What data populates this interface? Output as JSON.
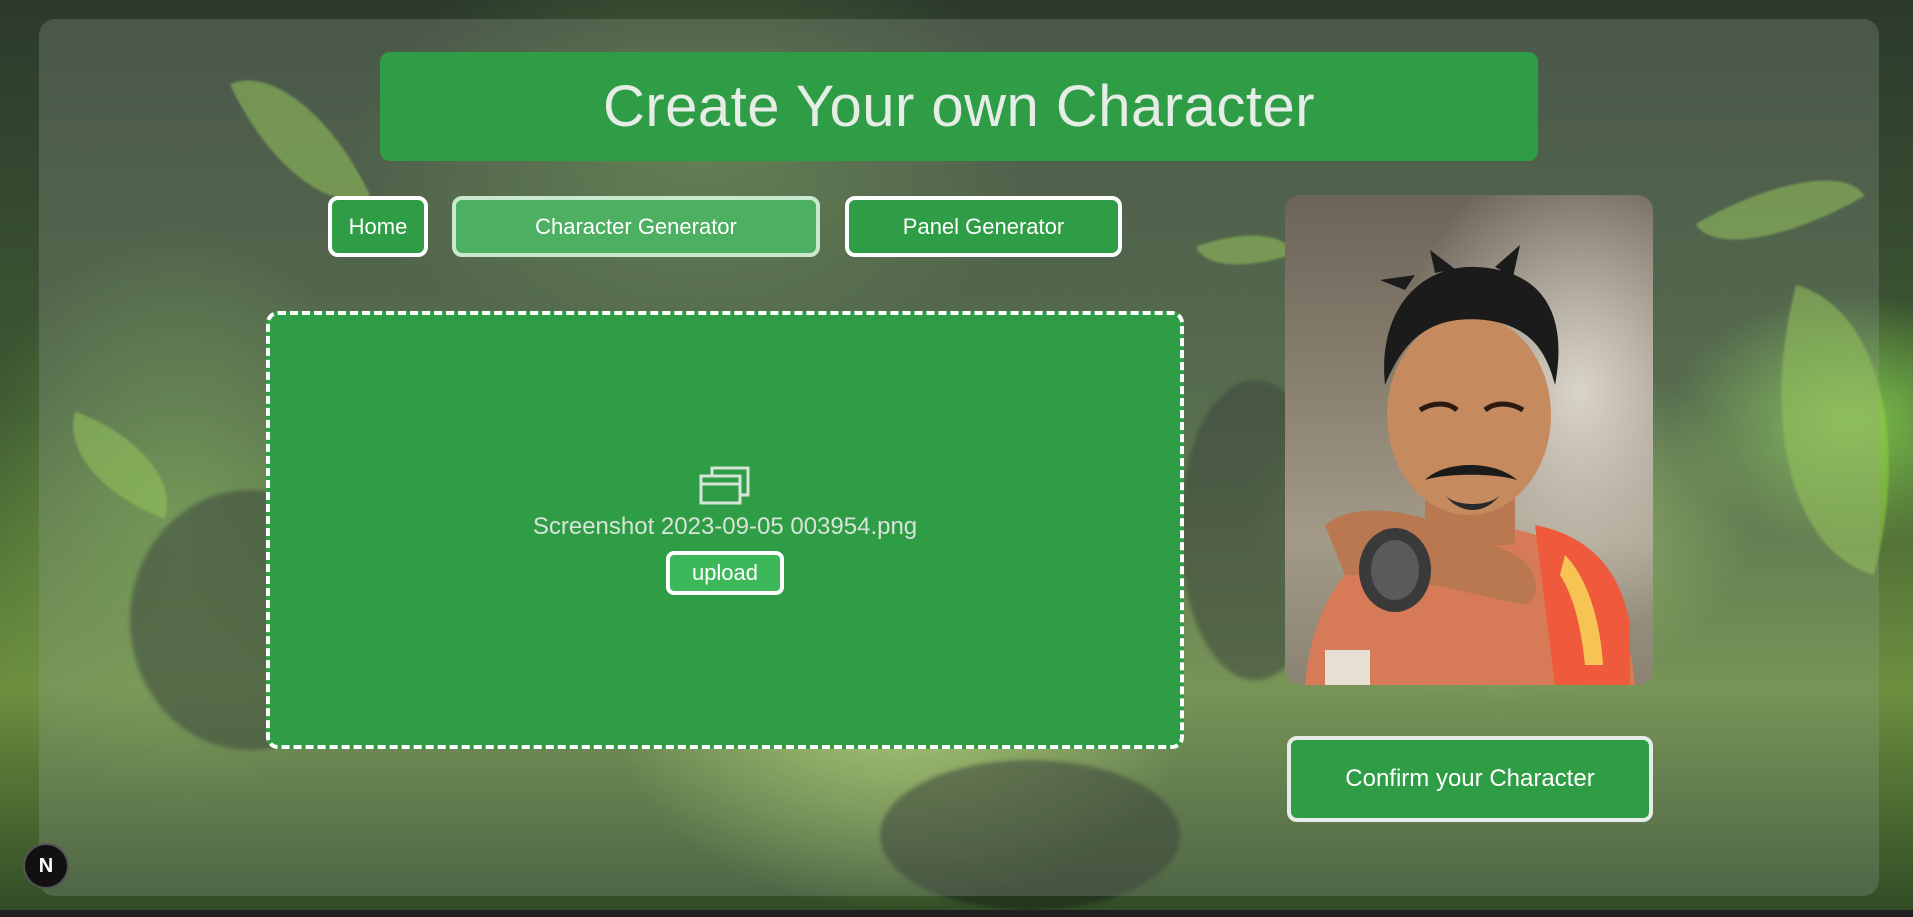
{
  "page": {
    "title": "Create Your own Character"
  },
  "nav": {
    "items": [
      {
        "label": "Home",
        "active": false
      },
      {
        "label": "Character Generator",
        "active": true
      },
      {
        "label": "Panel Generator",
        "active": false
      }
    ]
  },
  "upload": {
    "icon": "folder-icon",
    "file_name": "Screenshot 2023-09-05 003954.png",
    "button_label": "upload"
  },
  "preview": {
    "image_alt": "character-portrait"
  },
  "confirm": {
    "label": "Confirm your Character"
  },
  "badge": {
    "label": "N"
  },
  "colors": {
    "accent_green": "#2f9d46",
    "active_green": "#4caf61",
    "upload_green": "#3cb85a",
    "border_white": "#ffffff"
  }
}
